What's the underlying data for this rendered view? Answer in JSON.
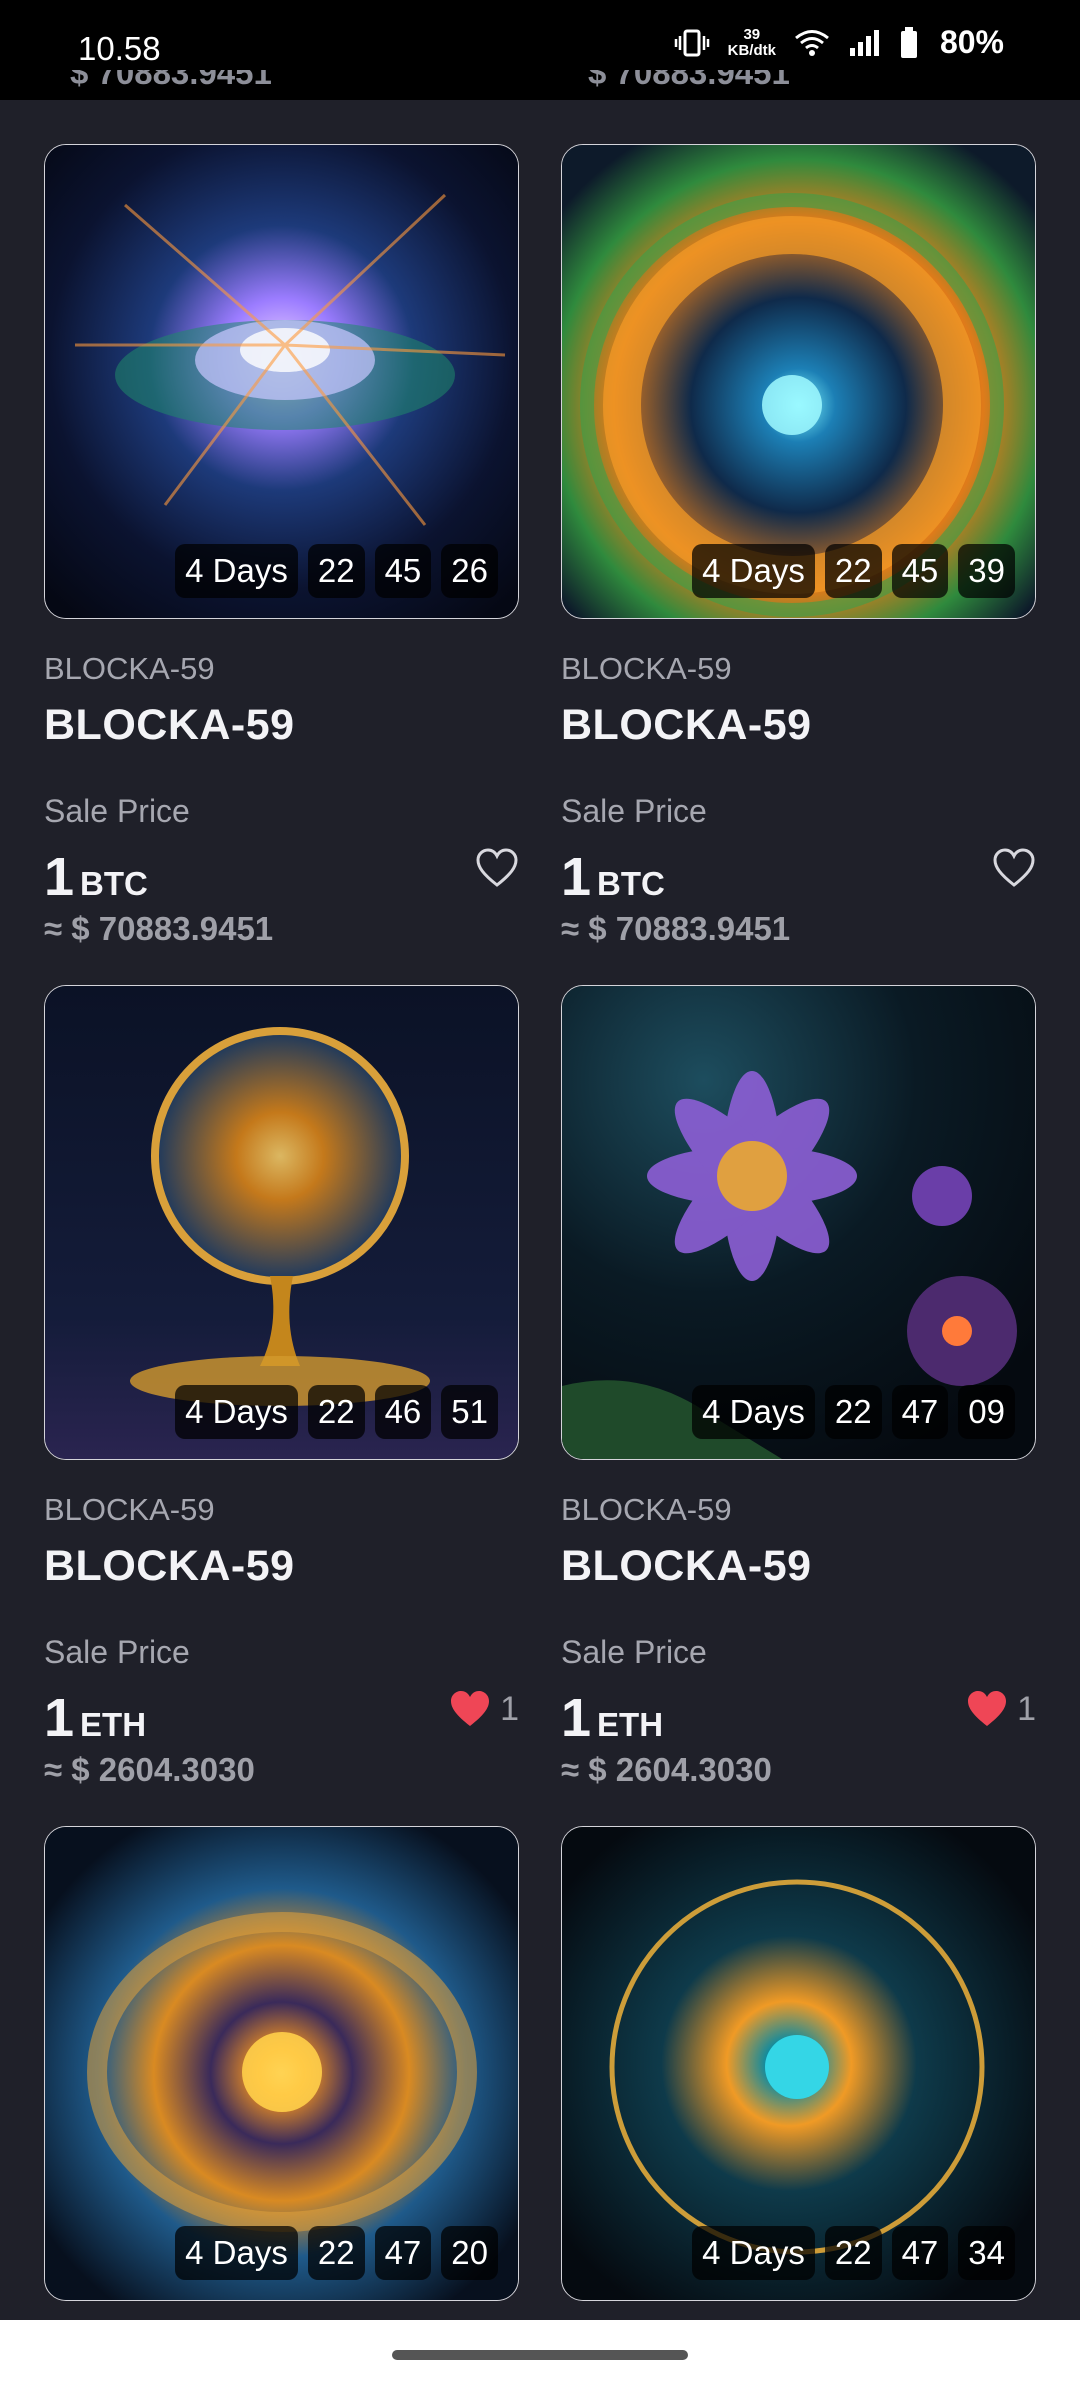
{
  "status": {
    "time": "10.58",
    "net_speed_value": "39",
    "net_speed_unit": "KB/dtk",
    "battery": "80%"
  },
  "cut_off": [
    "$ 70883.9451",
    "$ 70883.9451"
  ],
  "cards": [
    {
      "timer": [
        "4 Days",
        "22",
        "45",
        "26"
      ],
      "collection": "BLOCKA-59",
      "title": "BLOCKA-59",
      "sale_label": "Sale Price",
      "price": "1",
      "currency": "BTC",
      "usd": "≈ $ 70883.9451",
      "liked": false,
      "likes": ""
    },
    {
      "timer": [
        "4 Days",
        "22",
        "45",
        "39"
      ],
      "collection": "BLOCKA-59",
      "title": "BLOCKA-59",
      "sale_label": "Sale Price",
      "price": "1",
      "currency": "BTC",
      "usd": "≈ $ 70883.9451",
      "liked": false,
      "likes": ""
    },
    {
      "timer": [
        "4 Days",
        "22",
        "46",
        "51"
      ],
      "collection": "BLOCKA-59",
      "title": "BLOCKA-59",
      "sale_label": "Sale Price",
      "price": "1",
      "currency": "ETH",
      "usd": "≈ $ 2604.3030",
      "liked": true,
      "likes": "1"
    },
    {
      "timer": [
        "4 Days",
        "22",
        "47",
        "09"
      ],
      "collection": "BLOCKA-59",
      "title": "BLOCKA-59",
      "sale_label": "Sale Price",
      "price": "1",
      "currency": "ETH",
      "usd": "≈ $ 2604.3030",
      "liked": true,
      "likes": "1"
    },
    {
      "timer": [
        "4 Days",
        "22",
        "47",
        "20"
      ]
    },
    {
      "timer": [
        "4 Days",
        "22",
        "47",
        "34"
      ]
    }
  ],
  "colors": {
    "background": "#1f2029",
    "like_active": "#ef4656",
    "like_inactive": "#d8d8de"
  },
  "icons": [
    "vibrate-icon",
    "wifi-icon",
    "signal-icon",
    "battery-icon",
    "heart-outline-icon",
    "heart-filled-icon"
  ]
}
